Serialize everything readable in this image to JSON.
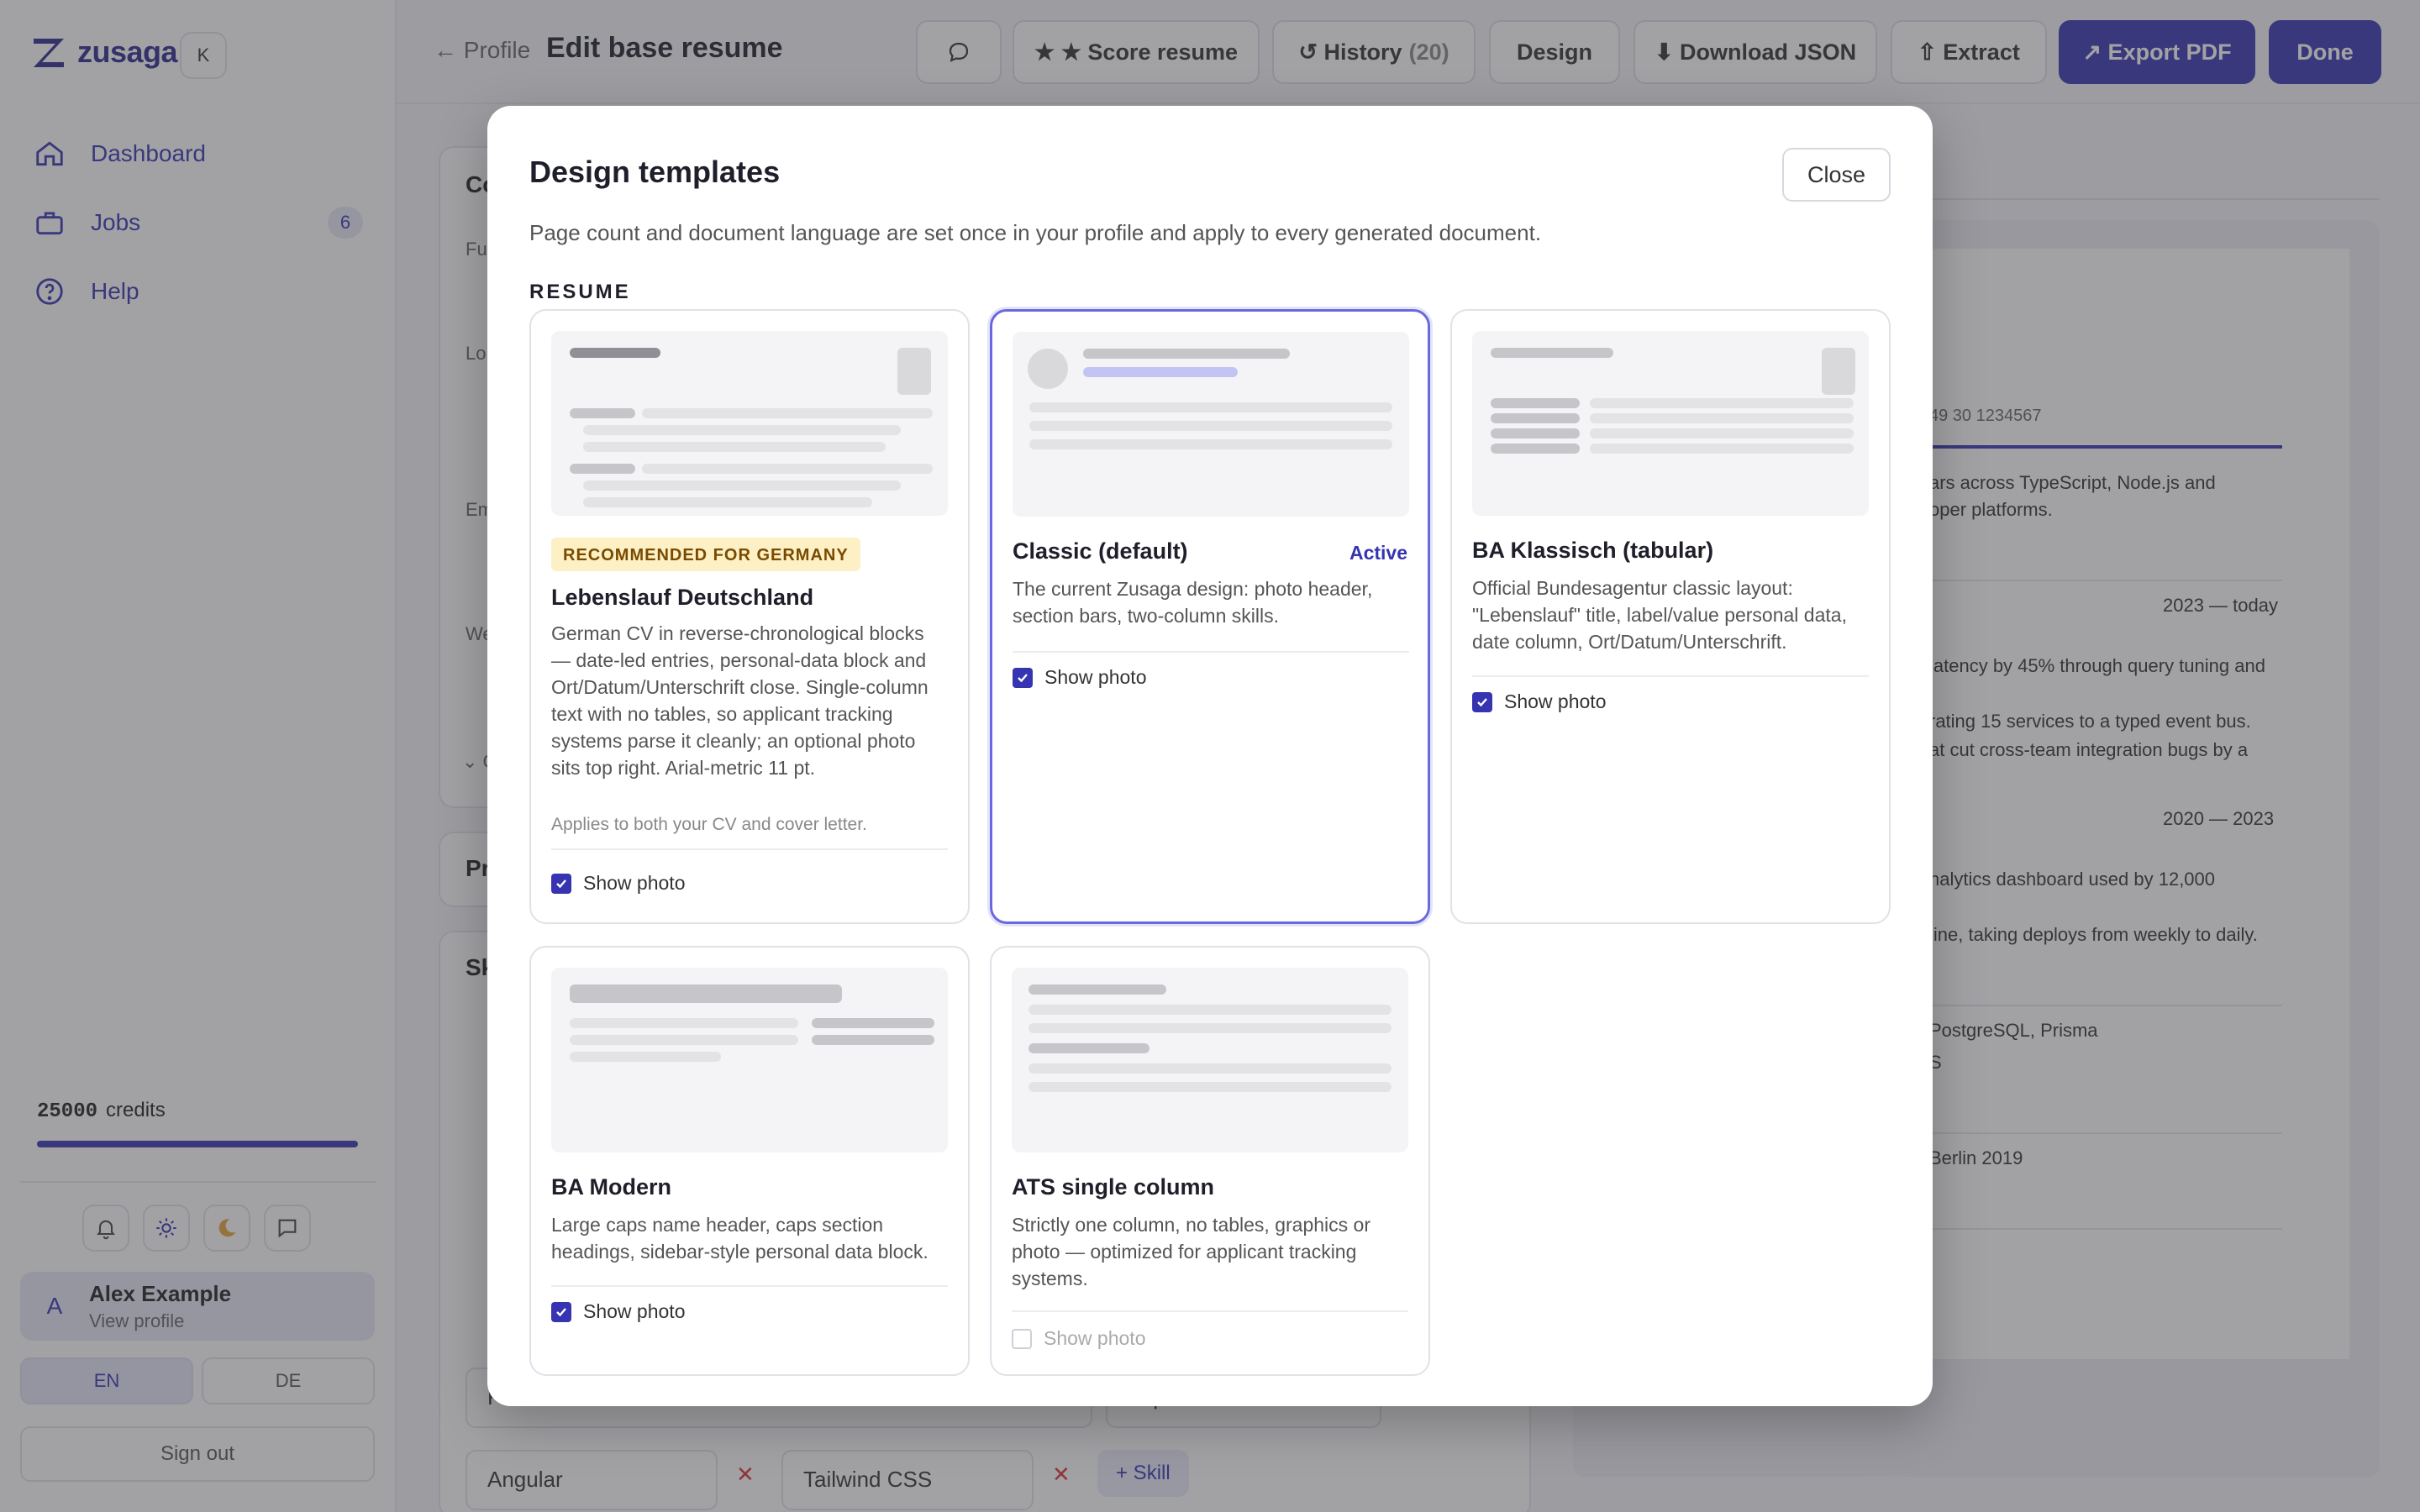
{
  "app": {
    "logo_text": "zusaga",
    "collapse_label": "K"
  },
  "sidebar": {
    "items": [
      {
        "label": "Dashboard",
        "icon": "home-icon"
      },
      {
        "label": "Jobs",
        "icon": "briefcase-icon",
        "badge": "6"
      },
      {
        "label": "Help",
        "icon": "help-circle-icon"
      }
    ],
    "credits_value": "25000",
    "credits_label": "credits",
    "credits_fill": 1.0,
    "quick_icons": [
      "bell-icon",
      "sun-icon",
      "moon-icon",
      "chat-icon"
    ],
    "user": {
      "initial": "A",
      "name": "Alex Example",
      "sub": "View profile"
    },
    "languages": [
      {
        "label": "EN",
        "active": true
      },
      {
        "label": "DE",
        "active": false
      }
    ],
    "sign_out": "Sign out"
  },
  "header": {
    "back": "← Profile",
    "title": "Edit base resume",
    "buttons": {
      "score": "★ ★ Score resume",
      "history": "↺ History",
      "history_count": "(20)",
      "design": "Design",
      "download": "⬇ Download JSON",
      "extract": "⇧ Extract",
      "export": "↗ Export PDF",
      "done": "Done"
    }
  },
  "background": {
    "headings": [
      "Co",
      "Pr",
      "Sk"
    ],
    "labels": [
      "Fu",
      "Lo",
      "Em",
      "We",
      "⌄ C"
    ],
    "skill_fields": [
      "Frontend",
      "Expert",
      "Angular",
      "Tailwind CSS"
    ],
    "add_skill": "+ Skill",
    "preview_lines": [
      "49 30 1234567",
      "ars across TypeScript, Node.js and",
      "oper platforms.",
      "2023 — today",
      "latency by 45% through query tuning and",
      "rating 15 services to a typed event bus.",
      "at cut cross-team integration bugs by a",
      "2020 — 2023",
      "nalytics dashboard used by 12,000",
      "line, taking deploys from weekly to daily.",
      "PostgreSQL, Prisma",
      "S",
      "Berlin 2019"
    ]
  },
  "modal": {
    "title": "Design templates",
    "close": "Close",
    "subtitle": "Page count and document language are set once in your profile and apply to every generated document.",
    "section": "RESUME",
    "templates": [
      {
        "badge": "RECOMMENDED FOR GERMANY",
        "name": "Lebenslauf Deutschland",
        "desc": "German CV in reverse-chronological blocks — date-led entries, personal-data block and Ort/Datum/Unterschrift close. Single-column text with no tables, so applicant tracking systems parse it cleanly; an optional photo sits top right. Arial-metric 11 pt.",
        "note": "Applies to both your CV and cover letter.",
        "show_photo": "Show photo",
        "checked": true
      },
      {
        "name": "Classic (default)",
        "active_label": "Active",
        "desc": "The current Zusaga design: photo header, section bars, two-column skills.",
        "show_photo": "Show photo",
        "checked": true
      },
      {
        "name": "BA Klassisch (tabular)",
        "desc": "Official Bundesagentur classic layout: \"Lebenslauf\" title, label/value personal data, date column, Ort/Datum/Unterschrift.",
        "show_photo": "Show photo",
        "checked": true
      },
      {
        "name": "BA Modern",
        "desc": "Large caps name header, caps section headings, sidebar-style personal data block.",
        "show_photo": "Show photo",
        "checked": true
      },
      {
        "name": "ATS single column",
        "desc": "Strictly one column, no tables, graphics or photo — optimized for applicant tracking systems.",
        "show_photo": "Show photo",
        "checked": false
      }
    ]
  },
  "colors": {
    "accent": "#3634b0",
    "badge_bg": "#fdf0c4",
    "badge_text": "#7a4a00"
  }
}
